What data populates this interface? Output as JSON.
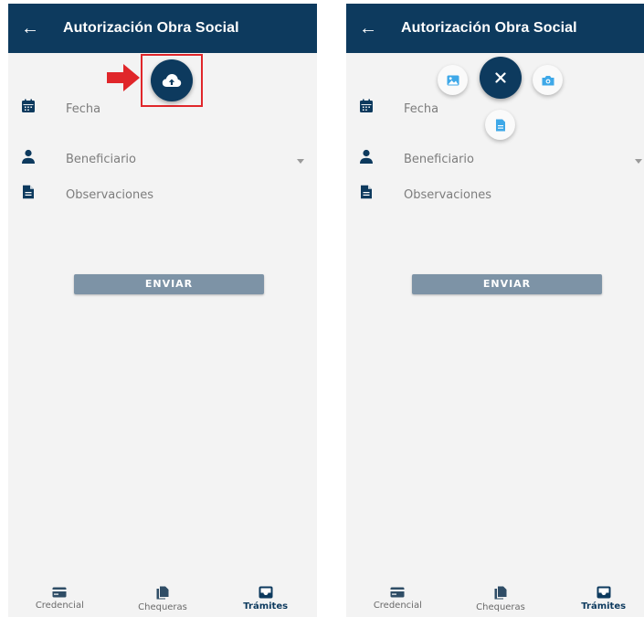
{
  "header": {
    "title": "Autorización Obra Social"
  },
  "form": {
    "fecha_label": "Fecha",
    "beneficiario_label": "Beneficiario",
    "observaciones_label": "Observaciones",
    "submit_label": "ENVIAR"
  },
  "bottom_nav": {
    "items": [
      {
        "label": "Credencial",
        "icon": "card-icon",
        "active": false
      },
      {
        "label": "Chequeras",
        "icon": "documents-icon",
        "active": false
      },
      {
        "label": "Trámites",
        "icon": "inbox-icon",
        "active": true
      }
    ]
  },
  "fab": {
    "collapsed_icon": "cloud-upload-icon",
    "expanded_icon": "close-icon",
    "options": [
      "image-icon",
      "camera-icon",
      "file-icon"
    ]
  },
  "colors": {
    "primary": "#0d3a5e",
    "background": "#f3f3f3",
    "button_disabled": "#7d93a6",
    "accent_light": "#3ea8e8",
    "annotation_red": "#e0262a"
  }
}
